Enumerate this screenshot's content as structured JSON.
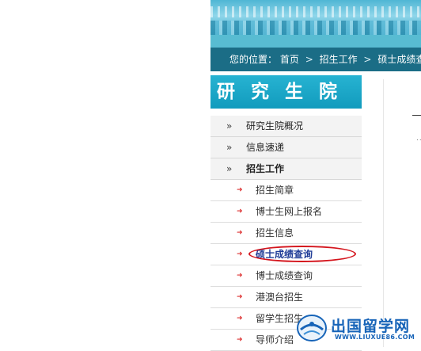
{
  "breadcrumb": {
    "prefix": "您的位置：",
    "items": [
      "首页",
      "招生工作",
      "硕士成绩查询"
    ],
    "separator": ">"
  },
  "sidebar": {
    "title": "研究生院",
    "nav": [
      {
        "label": "研究生院概况",
        "marker": "»"
      },
      {
        "label": "信息速递",
        "marker": "»"
      },
      {
        "label": "招生工作",
        "marker": "»",
        "bold": true
      }
    ],
    "sub_marker": "➜",
    "sub_items": [
      {
        "label": "招生简章"
      },
      {
        "label": "博士生网上报名"
      },
      {
        "label": "招生信息"
      },
      {
        "label": "硕士成绩查询",
        "active": true
      },
      {
        "label": "博士成绩查询"
      },
      {
        "label": "港澳台招生"
      },
      {
        "label": "留学生招生"
      },
      {
        "label": "导师介绍"
      }
    ]
  },
  "content": {
    "dots": "..."
  },
  "watermark": {
    "text": "出国留学网",
    "url": "WWW.LIUXUE86.COM",
    "color": "#1764b8"
  },
  "colors": {
    "breadcrumb_bg": "#1b6d86",
    "sidebar_title_bg": "#1aa7c8",
    "highlight_circle": "#d4141c",
    "active_link": "#1f3c97"
  }
}
